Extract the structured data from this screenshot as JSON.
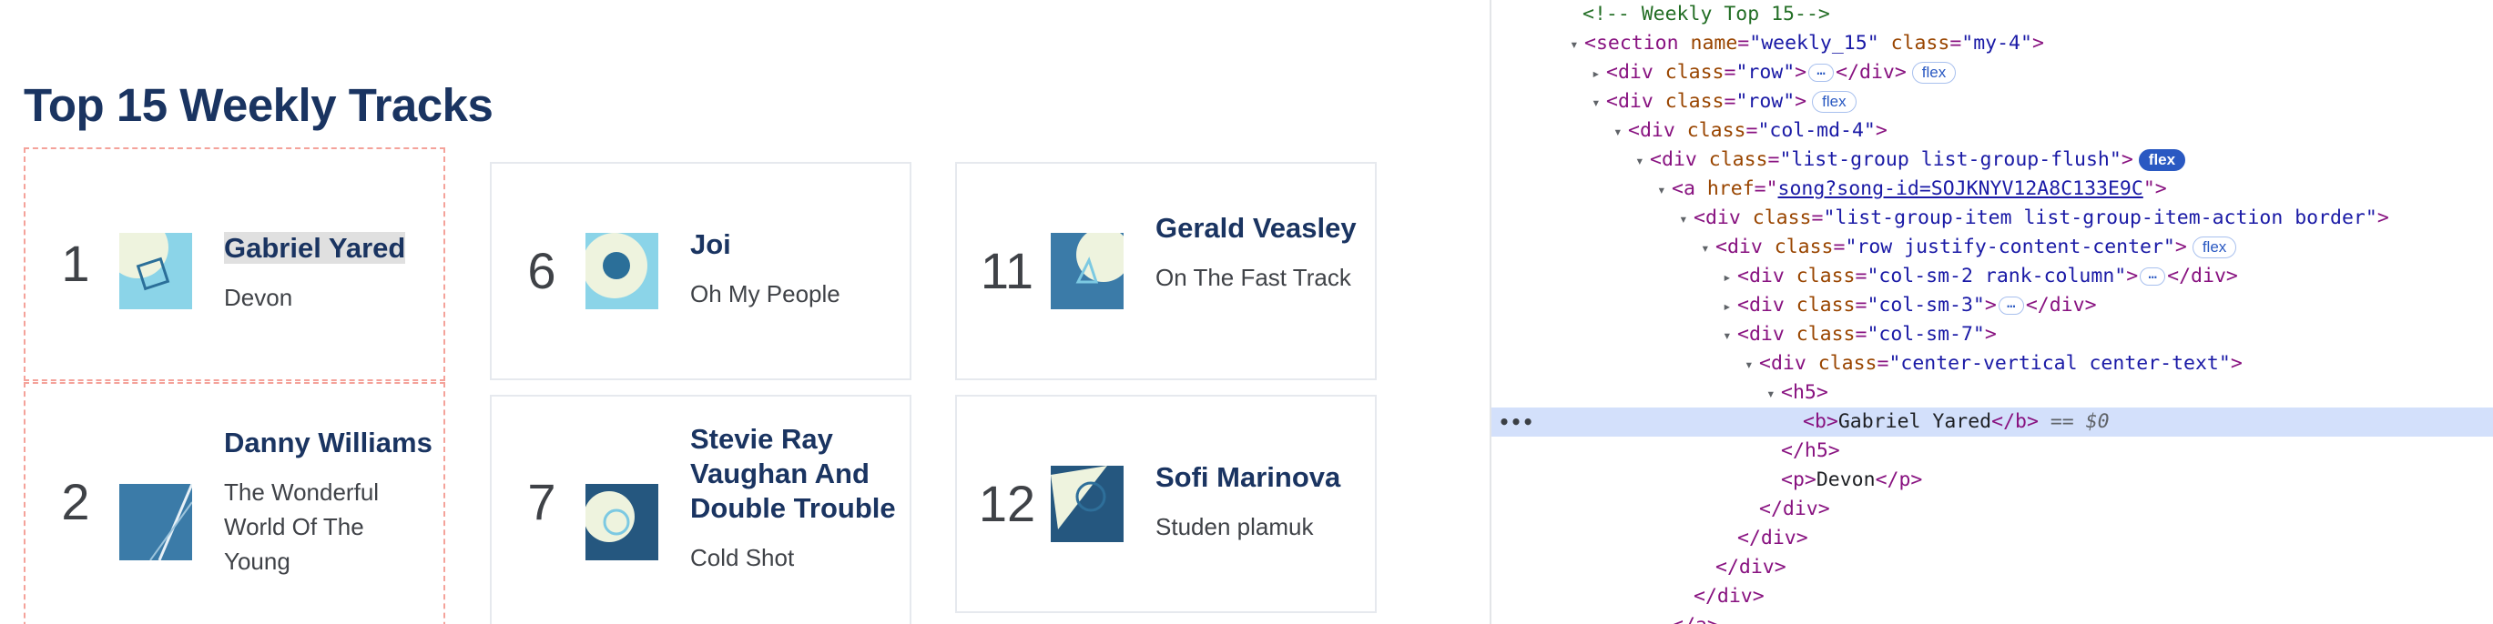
{
  "page": {
    "heading": "Top 15 Weekly Tracks",
    "tracks": [
      {
        "rank": "1",
        "artist": "Gabriel Yared",
        "song": "Devon",
        "thumb": "art-circle-square"
      },
      {
        "rank": "2",
        "artist": "Danny Williams",
        "song": "The Wonderful World Of The Young",
        "thumb": "art-diagonal-line"
      },
      {
        "rank": "6",
        "artist": "Joi",
        "song": "Oh My People",
        "thumb": "art-circle-dot"
      },
      {
        "rank": "7",
        "artist": "Stevie Ray Vaughan And Double Trouble",
        "song": "Cold Shot",
        "thumb": "art-circle-ring"
      },
      {
        "rank": "11",
        "artist": "Gerald Veasley",
        "song": "On The Fast Track",
        "thumb": "art-circle-triangle"
      },
      {
        "rank": "12",
        "artist": "Sofi Marinova",
        "song": "Studen plamuk",
        "thumb": "art-triangle-ring"
      }
    ]
  },
  "devtools": {
    "gutter_ellipsis": "•••",
    "lines": {
      "l0": {
        "comment": "<!-- Weekly Top 15-->"
      },
      "l1": {
        "tag": "section",
        "a1n": "name",
        "a1v": "\"weekly_15\"",
        "a2n": "class",
        "a2v": "\"my-4\""
      },
      "l2": {
        "tag": "div",
        "a1n": "class",
        "a1v": "\"row\"",
        "ellipsis": "…",
        "close": "</div>",
        "badge": "flex"
      },
      "l3": {
        "tag": "div",
        "a1n": "class",
        "a1v": "\"row\"",
        "badge": "flex"
      },
      "l4": {
        "tag": "div",
        "a1n": "class",
        "a1v": "\"col-md-4\""
      },
      "l5": {
        "tag": "div",
        "a1n": "class",
        "a1v": "\"list-group list-group-flush\"",
        "badge": "flex"
      },
      "l6": {
        "tag": "a",
        "a1n": "href",
        "a1v": "song?song-id=SOJKNYV12A8C133E9C"
      },
      "l7": {
        "tag": "div",
        "a1n": "class",
        "a1v": "\"list-group-item list-group-item-action border\""
      },
      "l8": {
        "tag": "div",
        "a1n": "class",
        "a1v": "\"row justify-content-center\"",
        "badge": "flex"
      },
      "l9": {
        "tag": "div",
        "a1n": "class",
        "a1v": "\"col-sm-2 rank-column\"",
        "ellipsis": "…",
        "close": "</div>"
      },
      "l10": {
        "tag": "div",
        "a1n": "class",
        "a1v": "\"col-sm-3\"",
        "ellipsis": "…",
        "close": "</div>"
      },
      "l11": {
        "tag": "div",
        "a1n": "class",
        "a1v": "\"col-sm-7\""
      },
      "l12": {
        "tag": "div",
        "a1n": "class",
        "a1v": "\"center-vertical center-text\""
      },
      "l13": {
        "open": "<h5>"
      },
      "l14": {
        "open": "<b>",
        "text": "Gabriel Yared",
        "close": "</b>",
        "eq": "==",
        "ref": "$0"
      },
      "l15": {
        "close": "</h5>"
      },
      "l16": {
        "open": "<p>",
        "text": "Devon",
        "close": "</p>"
      },
      "l17": {
        "close": "</div>"
      },
      "l18": {
        "close": "</div>"
      },
      "l19": {
        "close": "</div>"
      },
      "l20": {
        "close": "</div>"
      },
      "l21": {
        "close": "</a>"
      }
    }
  },
  "colors": {
    "heading": "#1a3461",
    "highlight_border": "#f4a29a",
    "selected_row": "#d3e0fb",
    "tag": "#881280",
    "attr_name": "#994500",
    "attr_value": "#1a1aa6",
    "comment": "#236e25"
  }
}
